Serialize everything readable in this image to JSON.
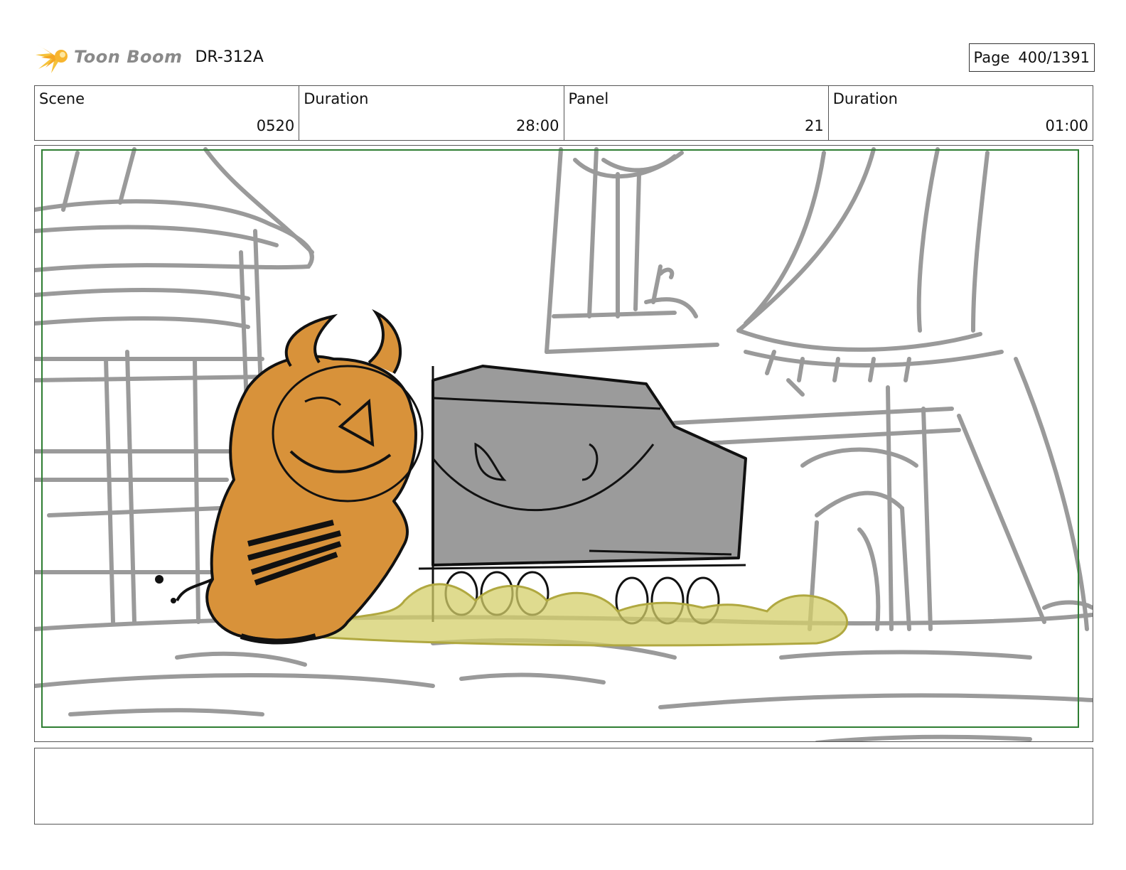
{
  "header": {
    "logo_text": "Toon Boom",
    "project_code": "DR-312A",
    "page_label": "Page",
    "page_value": "400/1391"
  },
  "info": {
    "scene_label": "Scene",
    "scene_value": "0520",
    "scene_duration_label": "Duration",
    "scene_duration_value": "28:00",
    "panel_label": "Panel",
    "panel_value": "21",
    "panel_duration_label": "Duration",
    "panel_duration_value": "01:00"
  },
  "colors": {
    "safe_frame": "#2e7d32",
    "sketch_gray": "#9a9a9a",
    "character_orange": "#d8923a",
    "vehicle_gray": "#9b9b9b",
    "dust_yellow": "#d4cf6a",
    "logo_star": "#f5a623"
  },
  "notes": ""
}
